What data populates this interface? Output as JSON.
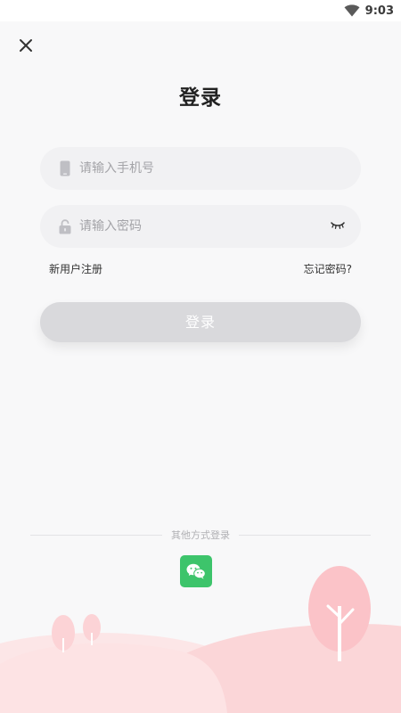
{
  "status_bar": {
    "time": "9:03",
    "icons": [
      "wifi-icon"
    ]
  },
  "header": {
    "close_icon": "close-icon",
    "title": "登录"
  },
  "form": {
    "phone": {
      "placeholder": "请输入手机号",
      "value": "",
      "icon": "phone-icon"
    },
    "password": {
      "placeholder": "请输入密码",
      "value": "",
      "icon": "lock-icon",
      "toggle_icon": "eye-closed-icon"
    }
  },
  "links": {
    "register": "新用户注册",
    "forgot": "忘记密码?"
  },
  "login_button": "登录",
  "other_login": {
    "label": "其他方式登录",
    "icon": "wechat-icon",
    "color": "#3dc46b"
  },
  "colors": {
    "button_disabled": "#d9d9dc",
    "field_bg": "#f1f1f3",
    "scenery_pink": "#fbd0d3"
  }
}
